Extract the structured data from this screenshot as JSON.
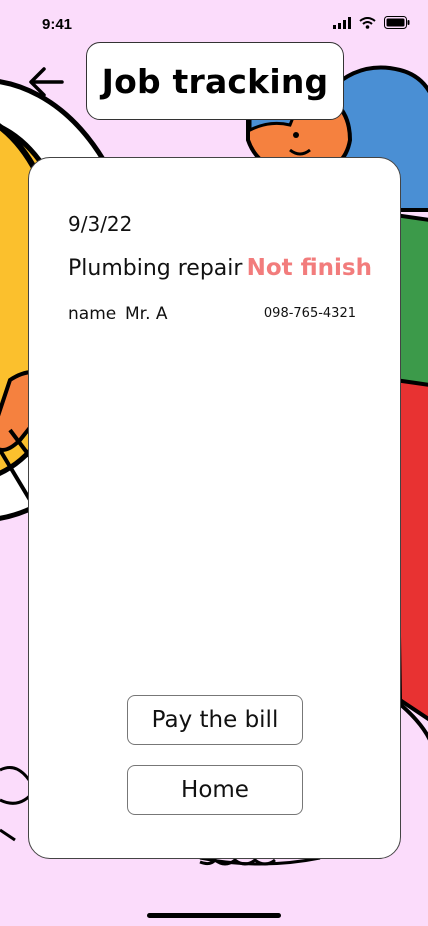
{
  "status_bar": {
    "time": "9:41"
  },
  "header": {
    "title": "Job tracking"
  },
  "job": {
    "date": "9/3/22",
    "title": "Plumbing repair",
    "status": "Not finish",
    "name_label": "name",
    "name_value": "Mr. A",
    "phone": "098-765-4321"
  },
  "actions": {
    "pay_label": "Pay the bill",
    "home_label": "Home"
  },
  "colors": {
    "background": "#fbdcfb",
    "status": "#f27c7c",
    "card": "#ffffff"
  }
}
